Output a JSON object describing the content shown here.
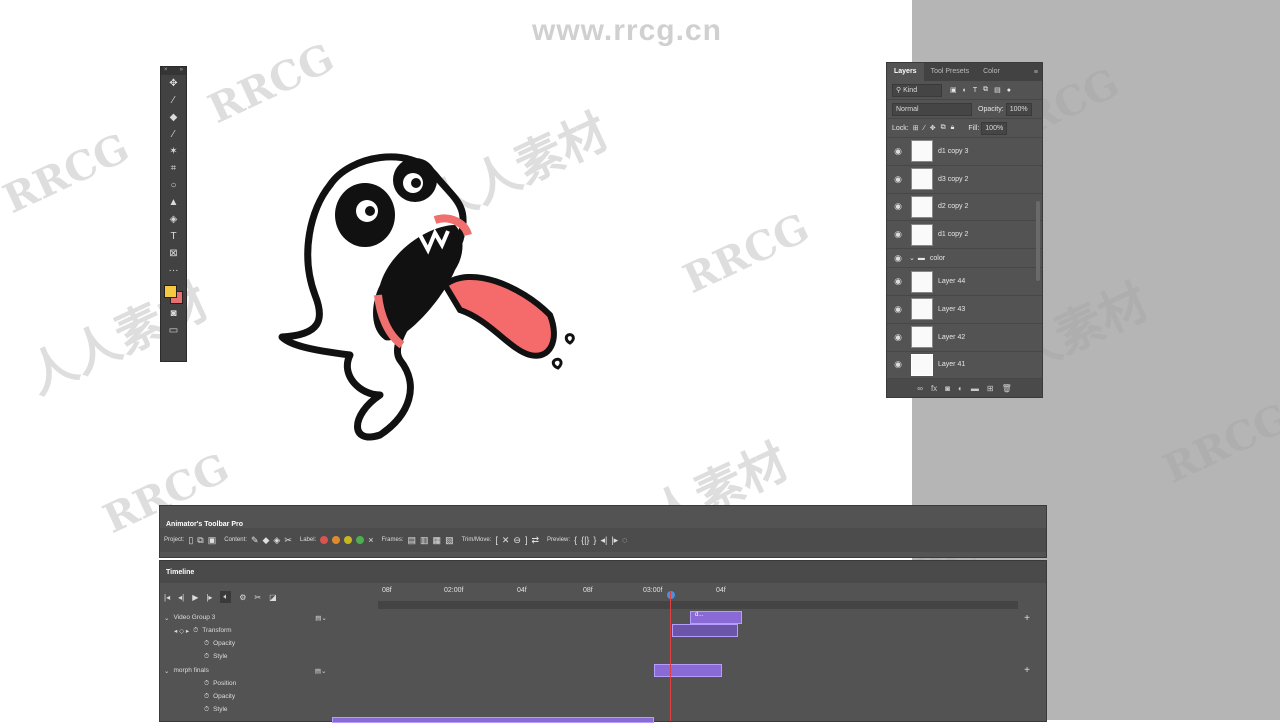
{
  "watermarks": {
    "url": "www.rrcg.cn",
    "brand": "RRCG",
    "cjk": "人人素材"
  },
  "toolbox": {
    "tools": [
      "move-tool-icon",
      "brush-icon",
      "eraser-icon",
      "eyedropper-icon",
      "magic-wand-icon",
      "crop-icon",
      "lasso-icon",
      "stamp-icon",
      "paint-bucket-icon",
      "type-icon",
      "frame-icon",
      "more-icon"
    ],
    "fg_color": "#f5c842",
    "bg_color": "#e87070"
  },
  "layers_panel": {
    "tabs": [
      "Layers",
      "Tool Presets",
      "Color"
    ],
    "filter_kind": "Kind",
    "blend_mode": "Normal",
    "opacity_label": "Opacity:",
    "opacity_value": "100%",
    "lock_label": "Lock:",
    "fill_label": "Fill:",
    "fill_value": "100%",
    "layers": [
      "d1 copy 3",
      "d3 copy 2",
      "d2 copy 2",
      "d1 copy 2"
    ],
    "group": "color",
    "group_layers": [
      "Layer 44",
      "Layer 43",
      "Layer 42",
      "Layer 41"
    ]
  },
  "animator_toolbar": {
    "title": "Animator's Toolbar Pro",
    "project_label": "Project:",
    "content_label": "Content:",
    "label_label": "Label:",
    "frames_label": "Frames:",
    "trim_label": "Trim/Move:",
    "preview_label": "Preview:",
    "label_colors": [
      "#d9534f",
      "#e08a2e",
      "#c8b820",
      "#4caf50"
    ]
  },
  "timeline": {
    "title": "Timeline",
    "ruler": [
      "08f",
      "02:00f",
      "04f",
      "08f",
      "03:00f",
      "04f"
    ],
    "tracks": [
      {
        "name": "Video Group 3",
        "group": true
      },
      {
        "name": "Transform",
        "group": false
      },
      {
        "name": "Opacity",
        "group": false
      },
      {
        "name": "Style",
        "group": false
      },
      {
        "name": "morph finals",
        "group": true
      },
      {
        "name": "Position",
        "group": false
      },
      {
        "name": "Opacity",
        "group": false
      },
      {
        "name": "Style",
        "group": false
      }
    ],
    "clip_label": "d..."
  }
}
